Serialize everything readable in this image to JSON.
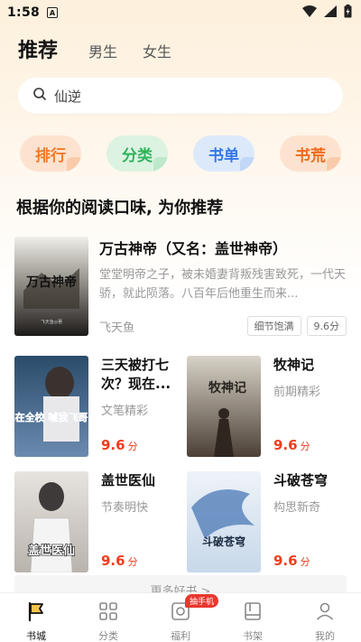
{
  "status_bar": {
    "time": "1:58",
    "indicator": "A"
  },
  "tabs": [
    {
      "label": "推荐",
      "active": true
    },
    {
      "label": "男生",
      "active": false
    },
    {
      "label": "女生",
      "active": false
    }
  ],
  "search": {
    "value": "仙逆"
  },
  "quick_links": [
    {
      "label": "排行",
      "color": "#f07a2a"
    },
    {
      "label": "分类",
      "color": "#2eb35b"
    },
    {
      "label": "书单",
      "color": "#3478e8"
    },
    {
      "label": "书荒",
      "color": "#f06a1c"
    }
  ],
  "section_title": "根据你的阅读口味, 为你推荐",
  "featured": {
    "title": "万古神帝（又名：盖世神帝）",
    "description": "堂堂明帝之子，被未婚妻背叛残害致死，一代天骄，就此陨落。八百年后他重生而来...",
    "author": "飞天鱼",
    "tags": [
      "细节饱满",
      "9.6分"
    ],
    "cover_text": "万古神帝",
    "cover_author": "飞天鱼◎著"
  },
  "books": [
    {
      "title": "三天被打七次？现在...",
      "subtitle": "文笔精彩",
      "score": "9.6",
      "unit": "分",
      "cover_text": "现在全校 喊我飞哥!"
    },
    {
      "title": "牧神记",
      "subtitle": "前期精彩",
      "score": "9.6",
      "unit": "分",
      "cover_text": "牧神记"
    },
    {
      "title": "盖世医仙",
      "subtitle": "节奏明快",
      "score": "9.6",
      "unit": "分",
      "cover_text": "盖世医仙"
    },
    {
      "title": "斗破苍穹",
      "subtitle": "构思新奇",
      "score": "9.6",
      "unit": "分",
      "cover_text": "斗破苍穹"
    }
  ],
  "more_label": "更多好书 >",
  "bottom_nav": [
    {
      "label": "书城",
      "icon": "bookstore-flag-icon",
      "active": true
    },
    {
      "label": "分类",
      "icon": "category-grid-icon",
      "active": false
    },
    {
      "label": "福利",
      "icon": "welfare-icon",
      "active": false,
      "badge": "抽手机"
    },
    {
      "label": "书架",
      "icon": "bookshelf-icon",
      "active": false
    },
    {
      "label": "我的",
      "icon": "profile-icon",
      "active": false
    }
  ]
}
